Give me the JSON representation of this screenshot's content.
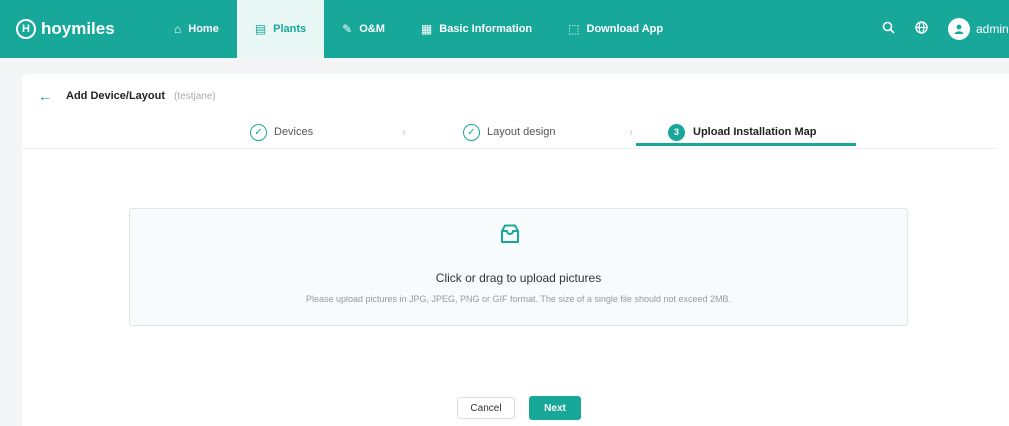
{
  "header": {
    "brand": "hoymiles",
    "nav": [
      {
        "label": "Home",
        "icon": "home-icon",
        "glyph": "⌂"
      },
      {
        "label": "Plants",
        "icon": "plants-icon",
        "glyph": "▤"
      },
      {
        "label": "O&M",
        "icon": "wrench-icon",
        "glyph": "✎"
      },
      {
        "label": "Basic Information",
        "icon": "document-icon",
        "glyph": "▦"
      },
      {
        "label": "Download App",
        "icon": "download-icon",
        "glyph": "⬚"
      }
    ],
    "user": "admin"
  },
  "page": {
    "title": "Add Device/Layout",
    "subtitle": "(testjane)"
  },
  "steps": [
    {
      "label": "Devices",
      "state": "done"
    },
    {
      "label": "Layout design",
      "state": "done"
    },
    {
      "label": "Upload Installation Map",
      "state": "current",
      "number": "3"
    }
  ],
  "upload": {
    "main_text": "Click or drag to upload pictures",
    "hint_text": "Please upload pictures in JPG, JPEG, PNG or GIF format. The size of a single file should not exceed 2MB."
  },
  "buttons": {
    "cancel": "Cancel",
    "next": "Next"
  },
  "colors": {
    "brand": "#17a89a"
  }
}
